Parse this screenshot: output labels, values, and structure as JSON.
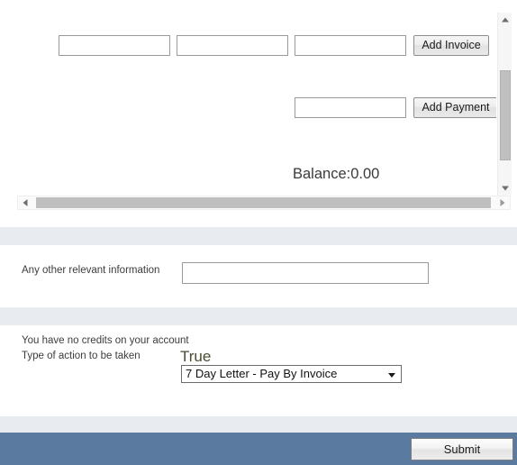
{
  "colors": {
    "band": "#e8ebf0",
    "footer": "#5b7a9f",
    "scroll_thumb": "#c0c0c0",
    "input_border": "#9a9a9a"
  },
  "invoice_panel": {
    "invoice_fields": [
      {
        "name": "invoice-field-1",
        "value": "",
        "placeholder": ""
      },
      {
        "name": "invoice-field-2",
        "value": "",
        "placeholder": ""
      },
      {
        "name": "invoice-field-3",
        "value": "",
        "placeholder": ""
      }
    ],
    "add_invoice_label": "Add Invoice",
    "payment_field": {
      "value": "",
      "placeholder": ""
    },
    "add_payment_label": "Add Payment",
    "balance_text": "Balance:0.00",
    "vertical_scrollbar": {
      "up_arrow_icon": "triangle-up-icon",
      "down_arrow_icon": "triangle-down-icon",
      "thumb": "scroll-thumb"
    },
    "horizontal_scrollbar": {
      "left_arrow_icon": "triangle-left-icon",
      "right_arrow_icon": "triangle-right-icon",
      "thumb": "scroll-thumb"
    }
  },
  "other_info": {
    "label": "Any other relevant information",
    "value": "",
    "placeholder": ""
  },
  "action_section": {
    "credits_message": "You have no credits on your account",
    "action_label": "Type of action to be taken",
    "true_flag": "True",
    "selected_option": "7 Day Letter - Pay By Invoice",
    "caret_icon": "chevron-down-icon"
  },
  "footer": {
    "submit_label": "Submit"
  }
}
